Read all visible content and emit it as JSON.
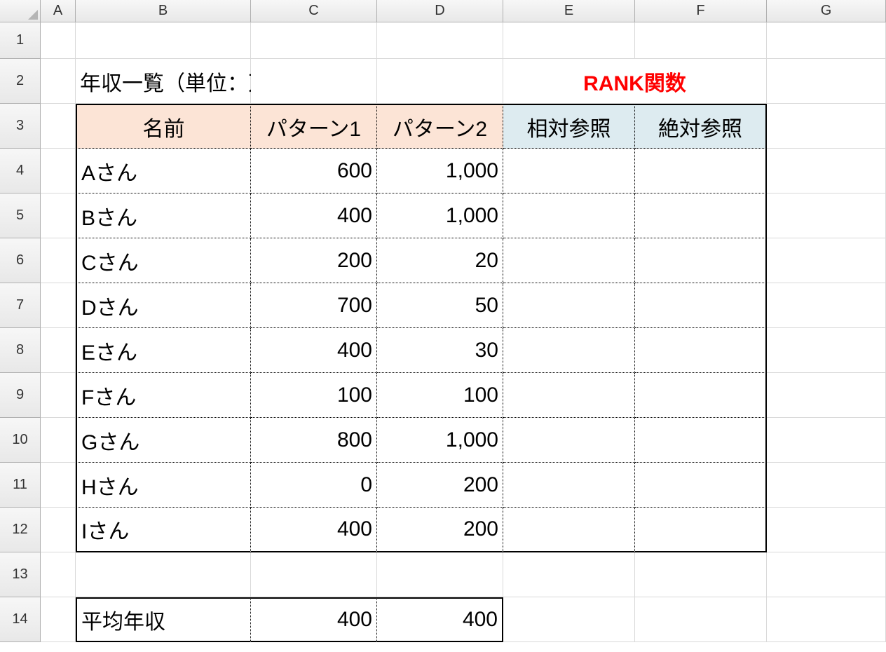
{
  "columns": [
    "A",
    "B",
    "C",
    "D",
    "E",
    "F",
    "G"
  ],
  "rows": [
    "1",
    "2",
    "3",
    "4",
    "5",
    "6",
    "7",
    "8",
    "9",
    "10",
    "11",
    "12",
    "13",
    "14"
  ],
  "titles": {
    "income_list": "年収一覧（単位：万円）",
    "rank_func": "RANK関数"
  },
  "headers": {
    "name": "名前",
    "pattern1": "パターン1",
    "pattern2": "パターン2",
    "relative_ref": "相対参照",
    "absolute_ref": "絶対参照"
  },
  "data": [
    {
      "name": "Aさん",
      "p1": "600",
      "p2": "1,000"
    },
    {
      "name": "Bさん",
      "p1": "400",
      "p2": "1,000"
    },
    {
      "name": "Cさん",
      "p1": "200",
      "p2": "20"
    },
    {
      "name": "Dさん",
      "p1": "700",
      "p2": "50"
    },
    {
      "name": "Eさん",
      "p1": "400",
      "p2": "30"
    },
    {
      "name": "Fさん",
      "p1": "100",
      "p2": "100"
    },
    {
      "name": "Gさん",
      "p1": "800",
      "p2": "1,000"
    },
    {
      "name": "Hさん",
      "p1": "0",
      "p2": "200"
    },
    {
      "name": "Iさん",
      "p1": "400",
      "p2": "200"
    }
  ],
  "average": {
    "label": "平均年収",
    "p1": "400",
    "p2": "400"
  },
  "chart_data": {
    "type": "table",
    "title_left": "年収一覧（単位：万円）",
    "title_right": "RANK関数",
    "columns": [
      "名前",
      "パターン1",
      "パターン2",
      "相対参照",
      "絶対参照"
    ],
    "rows": [
      [
        "Aさん",
        600,
        1000,
        null,
        null
      ],
      [
        "Bさん",
        400,
        1000,
        null,
        null
      ],
      [
        "Cさん",
        200,
        20,
        null,
        null
      ],
      [
        "Dさん",
        700,
        50,
        null,
        null
      ],
      [
        "Eさん",
        400,
        30,
        null,
        null
      ],
      [
        "Fさん",
        100,
        100,
        null,
        null
      ],
      [
        "Gさん",
        800,
        1000,
        null,
        null
      ],
      [
        "Hさん",
        0,
        200,
        null,
        null
      ],
      [
        "Iさん",
        400,
        200,
        null,
        null
      ]
    ],
    "summary": {
      "label": "平均年収",
      "パターン1": 400,
      "パターン2": 400
    }
  }
}
